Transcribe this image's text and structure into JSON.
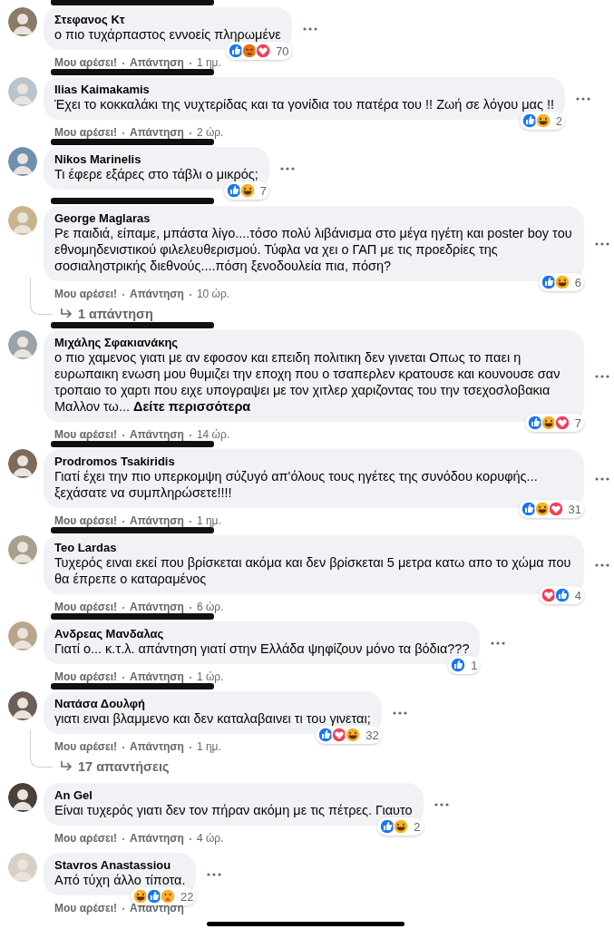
{
  "comments": [
    {
      "name": "Στεφανος Κτ",
      "redacted": true,
      "text": "ο πιο τυχάρπαστος εννοείς πληρωμένε",
      "reactions": [
        {
          "kind": "like"
        },
        {
          "kind": "angry"
        },
        {
          "kind": "love"
        }
      ],
      "count": "70",
      "actions": [
        "Μου αρέσει!",
        "Απάντηση"
      ],
      "time": "1 ημ."
    },
    {
      "name": "Ilias Kaimakamis",
      "redacted": true,
      "text": "Έχει το κοκκαλάκι της νυχτερίδας και τα γονίδια του πατέρα του !! Ζωή σε λόγου μας !!",
      "reactions": [
        {
          "kind": "like"
        },
        {
          "kind": "haha"
        }
      ],
      "count": "2",
      "actions": [
        "Μου αρέσει!",
        "Απάντηση"
      ],
      "time": "2 ώρ."
    },
    {
      "name": "Nikos Marinelis",
      "redacted": true,
      "text": "Τι έφερε εξάρες στο τάβλι ο μικρός;",
      "reactions": [
        {
          "kind": "like"
        },
        {
          "kind": "haha"
        }
      ],
      "count": "7"
    },
    {
      "name": "George Maglaras",
      "redacted": true,
      "text": "Ρε παιδιά, είπαμε, μπάστα λίγο....τόσο πολύ λιβάνισμα στο μέγα ηγέτη και poster boy του εθνομηδενιστικού φιλελευθερισμού. Τύφλα να χει ο ΓΑΠ με τις προεδρίες της σοσιαληστρικής διεθνούς....πόση ξενοδουλεία πια, πόση?",
      "reactions": [
        {
          "kind": "like"
        },
        {
          "kind": "haha"
        }
      ],
      "count": "6",
      "actions": [
        "Μου αρέσει!",
        "Απάντηση"
      ],
      "time": "10 ώρ.",
      "replies": "1 απάντηση"
    },
    {
      "name": "Μιχάλης Σφακιανάκης",
      "redacted": true,
      "text": "ο πιο χαμενος γιατι με αν εφοσον και επειδη πολιτικη δεν γινεται Οπως το παει η ευρωπαικη ενωση μου θυμιζει την εποχη που ο τσαπερλεν κρατουσε και κουνουσε σαν τροπαιο το χαρτι που ειχε υπογραψει με τον χιτλερ χαριζοντας του την τσεχοσλοβακια Μαλλον τω...",
      "see_more": "Δείτε περισσότερα",
      "reactions": [
        {
          "kind": "like"
        },
        {
          "kind": "haha"
        },
        {
          "kind": "love"
        }
      ],
      "count": "7",
      "actions": [
        "Μου αρέσει!",
        "Απάντηση"
      ],
      "time": "14 ώρ."
    },
    {
      "name": "Prodromos Tsakiridis",
      "redacted": true,
      "text": "Γιατί έχει την πιο υπερκομψη σύζυγό απ'όλους τους ηγέτες της συνόδου κορυφής... ξεχάσατε να συμπληρώσετε!!!!",
      "reactions": [
        {
          "kind": "like"
        },
        {
          "kind": "haha"
        },
        {
          "kind": "love"
        }
      ],
      "count": "31",
      "actions": [
        "Μου αρέσει!",
        "Απάντηση"
      ],
      "time": "1 ημ."
    },
    {
      "name": "Teo Lardas",
      "redacted": true,
      "text": "Τυχερός ειναι εκεί που βρίσκεται ακόμα και δεν βρίσκεται 5 μετρα κατω απο το χώμα που θα έπρεπε ο καταραμένος",
      "reactions": [
        {
          "kind": "love"
        },
        {
          "kind": "like"
        }
      ],
      "count": "4",
      "actions": [
        "Μου αρέσει!",
        "Απάντηση"
      ],
      "time": "6 ώρ."
    },
    {
      "name": "Ανδρεας Μανδαλας",
      "redacted": true,
      "text": "Γιατί ο... κ.τ.λ. απάντηση γιατί στην Ελλάδα ψηφίζουν μόνο τα βόδια???",
      "reactions": [
        {
          "kind": "like"
        }
      ],
      "count": "1",
      "actions": [
        "Μου αρέσει!",
        "Απάντηση"
      ],
      "time": "1 ώρ."
    },
    {
      "name": "Νατάσα Δουλφή",
      "redacted": true,
      "text": "γιατι ειναι βλαμμενο και δεν καταλαβαινει τι του γινεται;",
      "reactions": [
        {
          "kind": "like"
        },
        {
          "kind": "love"
        },
        {
          "kind": "haha"
        }
      ],
      "count": "32",
      "actions": [
        "Μου αρέσει!",
        "Απάντηση"
      ],
      "time": "1 ημ.",
      "replies": "17 απαντήσεις"
    },
    {
      "name": "An Gel",
      "redacted": false,
      "text": "Είναι τυχερός γιατι δεν τον πήραν ακόμη με τις πέτρες. Γιαυτο",
      "reactions": [
        {
          "kind": "like"
        },
        {
          "kind": "haha"
        }
      ],
      "count": "2",
      "actions": [
        "Μου αρέσει!",
        "Απάντηση"
      ],
      "time": "4 ώρ."
    },
    {
      "name": "Stavros Anastassiou",
      "redacted": false,
      "text": "Από τύχη άλλο τίποτα.",
      "reactions": [
        {
          "kind": "haha"
        },
        {
          "kind": "like"
        },
        {
          "kind": "care"
        }
      ],
      "count": "22",
      "actions": [
        "Μου αρέσει!",
        "Απάντηση"
      ]
    }
  ]
}
